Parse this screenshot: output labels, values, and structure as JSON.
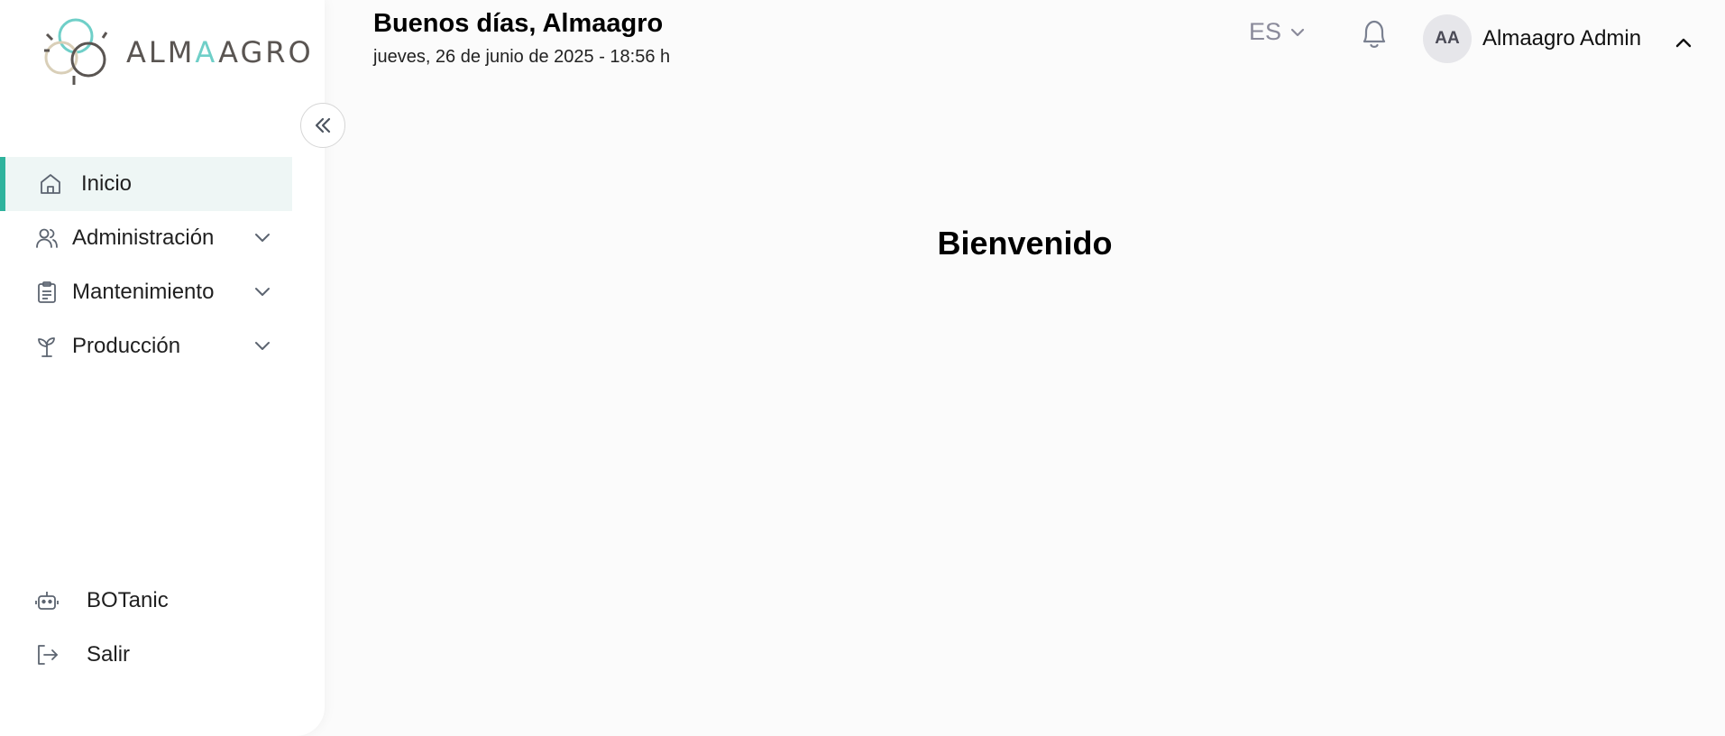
{
  "sidebar": {
    "logo_text_a": "ALM",
    "logo_text_accent": "A",
    "logo_text_b": "AGRO",
    "items": [
      {
        "label": "Inicio",
        "icon": "home-icon",
        "active": true
      },
      {
        "label": "Administración",
        "icon": "users-icon",
        "expandable": true
      },
      {
        "label": "Mantenimiento",
        "icon": "clipboard-icon",
        "expandable": true
      },
      {
        "label": "Producción",
        "icon": "sprout-icon",
        "expandable": true
      }
    ],
    "bottom_items": [
      {
        "label": "BOTanic",
        "icon": "robot-icon"
      },
      {
        "label": "Salir",
        "icon": "logout-icon"
      }
    ],
    "collapse_icon": "double-chevron-left-icon"
  },
  "header": {
    "greeting": "Buenos días, Almaagro",
    "date": "jueves, 26 de junio de 2025 - 18:56 h",
    "language": "ES",
    "notification_icon": "bell-icon",
    "user": {
      "initials": "AA",
      "name": "Almaagro Admin"
    }
  },
  "main": {
    "welcome": "Bienvenido"
  },
  "colors": {
    "accent": "#2fb39d",
    "active_bg": "#eef6f5",
    "logo_teal": "#6fcfc8",
    "logo_gray": "#5a5552",
    "logo_beige": "#d9cfb8"
  }
}
